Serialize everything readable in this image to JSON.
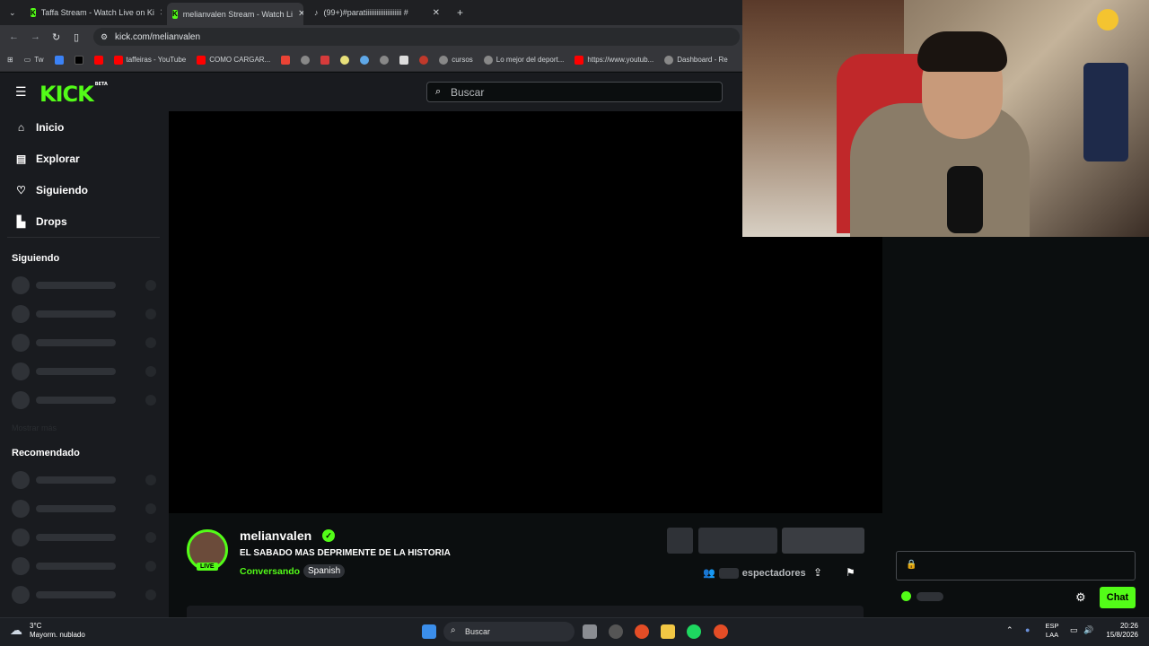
{
  "browser": {
    "tabs": [
      {
        "label": "Taffa Stream - Watch Live on Ki"
      },
      {
        "label": "melianvalen Stream - Watch Li"
      },
      {
        "label": "(99+)#paratiiiiiiiiiiiiiiiiiiii #"
      }
    ],
    "url": "kick.com/melianvalen",
    "bookmarks": [
      "Tw",
      "taffeiras - YouTube",
      "COMO CARGAR...",
      "cursos",
      "Lo mejor del deport...",
      "https://www.youtub...",
      "Dashboard - Re"
    ]
  },
  "header": {
    "logo": "KICK",
    "logo_badge": "BETA",
    "search_placeholder": "Buscar"
  },
  "sidebar": {
    "nav": [
      {
        "label": "Inicio",
        "icon": "home-icon"
      },
      {
        "label": "Explorar",
        "icon": "explore-icon"
      },
      {
        "label": "Siguiendo",
        "icon": "heart-icon"
      },
      {
        "label": "Drops",
        "icon": "drops-icon"
      }
    ],
    "following_title": "Siguiendo",
    "show_more": "Mostrar más",
    "recommended_title": "Recomendado"
  },
  "stream": {
    "channel": "melianvalen",
    "live_badge": "LIVE",
    "title": "EL SABADO MAS DEPRIMENTE DE LA HISTORIA",
    "category": "Conversando",
    "language": "Spanish",
    "viewers_label": "espectadores"
  },
  "chat": {
    "button": "Chat"
  },
  "taskbar": {
    "temp": "3°C",
    "weather": "Mayorm. nublado",
    "search": "Buscar",
    "lang_line1": "ESP",
    "lang_line2": "LAA",
    "time": "20:26",
    "date": "15/8/2026"
  },
  "colors": {
    "accent": "#53fc18",
    "panel": "#191b1f",
    "bg": "#0b0e0f"
  }
}
